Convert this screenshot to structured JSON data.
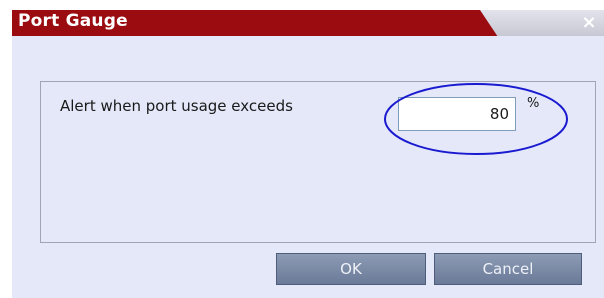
{
  "window": {
    "title": "Port Gauge",
    "close_glyph": "×",
    "title_bar_color": "#9a0c10",
    "background_color": "#e4e8f8"
  },
  "form": {
    "alert_label": "Alert when port usage exceeds",
    "threshold_value": "80",
    "unit_label": "%"
  },
  "annotation": {
    "shape": "ellipse",
    "color": "#1a1ad0"
  },
  "buttons": {
    "ok_label": "OK",
    "cancel_label": "Cancel",
    "color": "#7a89a6"
  }
}
